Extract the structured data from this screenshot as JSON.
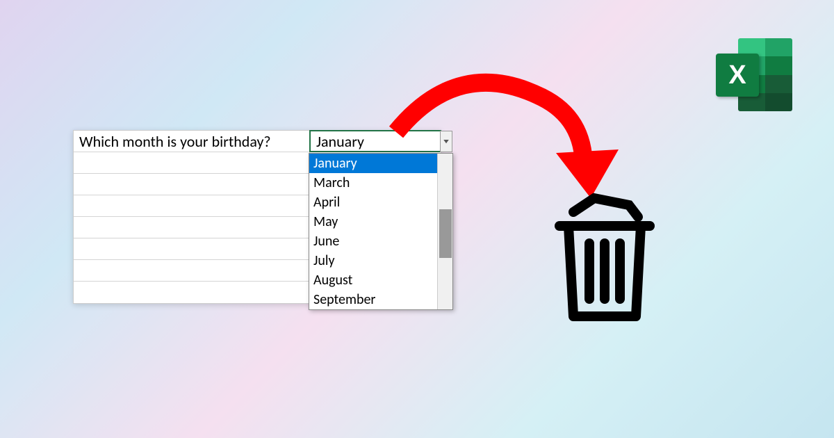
{
  "question": "Which month is your birthday?",
  "selected_value": "January",
  "dropdown_items": [
    "January",
    "March",
    "April",
    "May",
    "June",
    "July",
    "August",
    "September"
  ],
  "highlighted_index": 0,
  "excel_logo_letter": "X"
}
